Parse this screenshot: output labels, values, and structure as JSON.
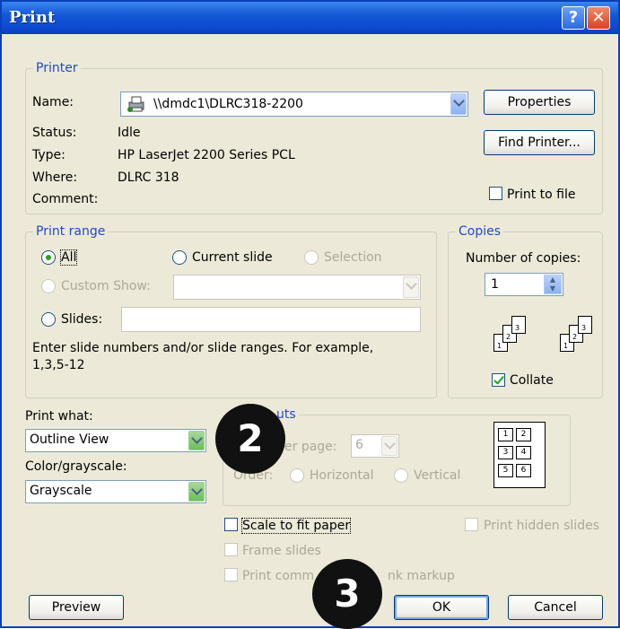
{
  "window": {
    "title": "Print"
  },
  "printer": {
    "legend": "Printer",
    "name_label": "Name:",
    "name_value": "\\\\dmdc1\\DLRC318-2200",
    "status_label": "Status:",
    "status_value": "Idle",
    "type_label": "Type:",
    "type_value": "HP LaserJet 2200 Series PCL",
    "where_label": "Where:",
    "where_value": "DLRC 318",
    "comment_label": "Comment:",
    "properties_button": "Properties",
    "find_printer_button": "Find Printer...",
    "print_to_file": "Print to file"
  },
  "print_range": {
    "legend": "Print range",
    "all": "All",
    "current_slide": "Current slide",
    "selection": "Selection",
    "custom_show": "Custom Show:",
    "slides": "Slides:",
    "hint": "Enter slide numbers and/or slide ranges. For example,",
    "hint_example": "1,3,5-12"
  },
  "copies": {
    "legend": "Copies",
    "number_label": "Number of copies:",
    "number_value": "1",
    "collate": "Collate",
    "page_numbers": [
      "1",
      "2",
      "3"
    ]
  },
  "print_what": {
    "label": "Print what:",
    "value": "Outline View"
  },
  "color": {
    "label": "Color/grayscale:",
    "value": "Grayscale"
  },
  "handouts": {
    "legend_visible": "uts",
    "per_page_label_visible": "er page:",
    "per_page_value": "6",
    "order_label": "Order:",
    "horizontal": "Horizontal",
    "vertical": "Vertical",
    "preview_cells": [
      "1",
      "2",
      "3",
      "4",
      "5",
      "6"
    ]
  },
  "options": {
    "scale_to_fit": "Scale to fit paper",
    "frame_slides": "Frame slides",
    "print_comments_visible_start": "Print comm",
    "print_comments_visible_end": "nk markup",
    "print_hidden": "Print hidden slides"
  },
  "buttons": {
    "preview": "Preview",
    "ok": "OK",
    "cancel": "Cancel"
  },
  "badges": {
    "step2": "2",
    "step3": "3"
  }
}
